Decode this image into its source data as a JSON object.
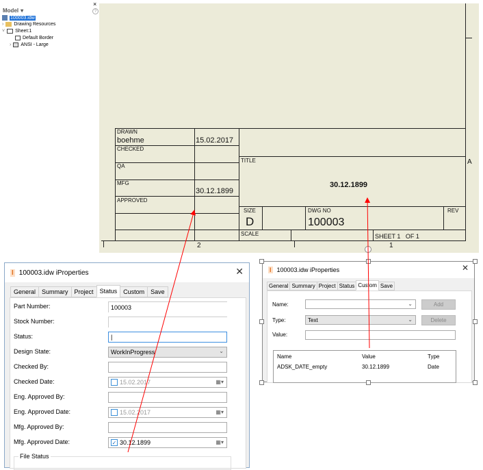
{
  "browser": {
    "title": "Model",
    "help_icon": "?",
    "close_icon": "×",
    "items": [
      {
        "label": "100003.idw"
      },
      {
        "label": "Drawing Resources"
      },
      {
        "label": "Sheet:1"
      },
      {
        "label": "Default Border"
      },
      {
        "label": "ANSI - Large"
      }
    ]
  },
  "title_block": {
    "drawn_label": "DRAWN",
    "drawn_by": "boehme",
    "drawn_date": "15.02.2017",
    "checked_label": "CHECKED",
    "qa_label": "QA",
    "mfg_label": "MFG",
    "mfg_date": "30.12.1899",
    "approved_label": "APPROVED",
    "title_label": "TITLE",
    "title_value": "30.12.1899",
    "size_label": "SIZE",
    "size_value": "D",
    "dwg_no_label": "DWG NO",
    "dwg_no_value": "100003",
    "rev_label": "REV",
    "scale_label": "SCALE",
    "sheet_label": "SHEET 1   OF 1",
    "zone_2": "2",
    "zone_1": "1",
    "zone_a": "A"
  },
  "dialog_status": {
    "title": "100003.idw iProperties",
    "tabs": [
      "General",
      "Summary",
      "Project",
      "Status",
      "Custom",
      "Save"
    ],
    "active_tab": "Status",
    "fields": [
      {
        "label": "Part Number:",
        "value": "100003"
      },
      {
        "label": "Stock Number:",
        "value": ""
      },
      {
        "label": "Status:",
        "value": "|"
      },
      {
        "label": "Design State:",
        "value": "WorkInProgress"
      },
      {
        "label": "Checked By:",
        "value": ""
      },
      {
        "label": "Checked Date:",
        "value": "15.02.2017"
      },
      {
        "label": "Eng. Approved By:",
        "value": ""
      },
      {
        "label": "Eng. Approved Date:",
        "value": "15.02.2017"
      },
      {
        "label": "Mfg. Approved By:",
        "value": ""
      },
      {
        "label": "Mfg. Approved Date:",
        "value": "30.12.1899"
      }
    ],
    "file_status_label": "File Status"
  },
  "dialog_custom": {
    "title": "100003.idw iProperties",
    "tabs": [
      "General",
      "Summary",
      "Project",
      "Status",
      "Custom",
      "Save"
    ],
    "active_tab": "Custom",
    "name_label": "Name:",
    "type_label": "Type:",
    "type_value": "Text",
    "value_label": "Value:",
    "add_label": "Add",
    "delete_label": "Delete",
    "columns": [
      "Name",
      "Value",
      "Type"
    ],
    "rows": [
      {
        "name": "ADSK_DATE_empty",
        "value": "30.12.1899",
        "type": "Date"
      }
    ]
  },
  "colors": {
    "sheet": "#ecebd9",
    "annotation": "#ff0000"
  }
}
